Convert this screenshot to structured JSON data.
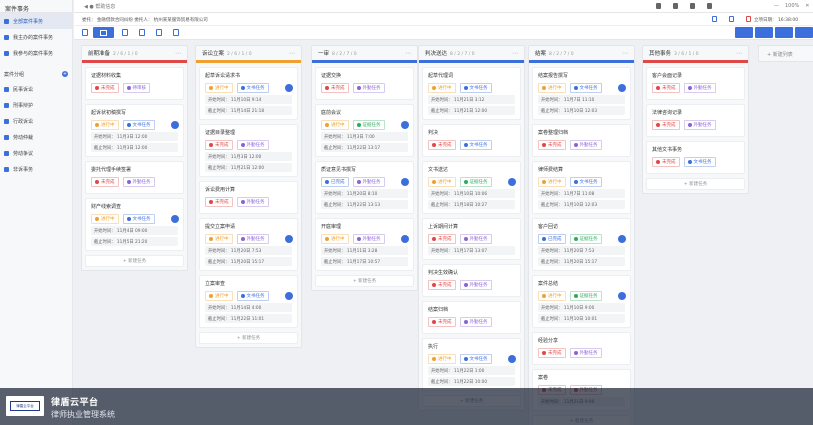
{
  "sidebar": {
    "title": "案件事务",
    "items": [
      "全部案件事务",
      "我主办的案件事务",
      "我参与的案件事务"
    ],
    "group_title": "案件分组",
    "groups": [
      "民事诉讼",
      "刑事辩护",
      "行政诉讼",
      "劳动仲裁",
      "劳动争议",
      "非诉事务"
    ]
  },
  "topbar": {
    "crumb": "◀  ●  帮助信息",
    "zoom": "100%",
    "minimize": "—",
    "close": "✕"
  },
  "infobar": {
    "text": "委托：  金融借款合同纠纷      委托人： 杭州某某服饰贸易有限公司",
    "time_label": "立项日期：",
    "time_value": "16:38:00"
  },
  "new_column_label": "+ 新建列表",
  "add_task_label": "+ 新建任务",
  "colors": {
    "accent": "#3d6fdc",
    "red": "#e04848",
    "orange": "#f0a030",
    "green": "#2faa5c"
  },
  "columns": [
    {
      "title": "前期准备",
      "count": "2 / 6 / 1 / 0",
      "bar": "#e04848",
      "cards": [
        {
          "title": "证据材料收集",
          "tags": [
            {
              "text": "未完成",
              "c": "#e04848"
            },
            {
              "text": "待审核",
              "c": "#8a63d2"
            }
          ],
          "dates": [],
          "avatar": false
        },
        {
          "title": "起诉状初稿撰写",
          "tags": [
            {
              "text": "进行中",
              "c": "#f0a030"
            },
            {
              "text": "文书任务",
              "c": "#3d6fdc"
            }
          ],
          "dates": [
            "开始时间： 11月3日 12:00",
            "截止时间： 11月3日 12:00"
          ],
          "avatar": true
        },
        {
          "title": "委托代理手续签署",
          "tags": [
            {
              "text": "未完成",
              "c": "#e04848"
            },
            {
              "text": "外勤任务",
              "c": "#8a63d2"
            }
          ],
          "dates": [],
          "avatar": false
        },
        {
          "title": "财产线索调查",
          "tags": [
            {
              "text": "进行中",
              "c": "#f0a030"
            },
            {
              "text": "文书任务",
              "c": "#3d6fdc"
            }
          ],
          "dates": [
            "开始时间： 11月4日 09:00",
            "截止时间： 11月5日 21:20"
          ],
          "avatar": true
        }
      ]
    },
    {
      "title": "诉讼立案",
      "count": "2 / 6 / 1 / 0",
      "bar": "#f0a030",
      "cards": [
        {
          "title": "起草诉讼请求书",
          "tags": [
            {
              "text": "进行中",
              "c": "#f0a030"
            },
            {
              "text": "文书任务",
              "c": "#3d6fdc"
            }
          ],
          "dates": [
            "开始时间： 11月10日 9:14",
            "截止时间： 11月14日 21:18"
          ],
          "avatar": true
        },
        {
          "title": "证据目录整理",
          "tags": [
            {
              "text": "未完成",
              "c": "#e04848"
            },
            {
              "text": "外勤任务",
              "c": "#8a63d2"
            }
          ],
          "dates": [
            "开始时间： 11月3日 12:00",
            "截止时间： 11月21日 12:00"
          ],
          "avatar": false
        },
        {
          "title": "诉讼费用计算",
          "tags": [
            {
              "text": "未完成",
              "c": "#e04848"
            },
            {
              "text": "外勤任务",
              "c": "#8a63d2"
            }
          ],
          "dates": [],
          "avatar": false
        },
        {
          "title": "提交立案申请",
          "tags": [
            {
              "text": "进行中",
              "c": "#f0a030"
            },
            {
              "text": "外勤任务",
              "c": "#8a63d2"
            }
          ],
          "dates": [
            "开始时间： 11月20日 7:53",
            "截止时间： 11月20日 15:17"
          ],
          "avatar": true
        },
        {
          "title": "立案审查",
          "tags": [
            {
              "text": "进行中",
              "c": "#f0a030"
            },
            {
              "text": "文书任务",
              "c": "#3d6fdc"
            }
          ],
          "dates": [
            "开始时间： 11月14日 4:00",
            "截止时间： 11月22日 11:01"
          ],
          "avatar": true
        }
      ]
    },
    {
      "title": "一审",
      "count": "8 / 2 / 7 / 0",
      "bar": "#3d6fdc",
      "cards": [
        {
          "title": "证据交换",
          "tags": [
            {
              "text": "未完成",
              "c": "#e04848"
            },
            {
              "text": "外勤任务",
              "c": "#8a63d2"
            }
          ],
          "dates": [],
          "avatar": false
        },
        {
          "title": "庭前会议",
          "tags": [
            {
              "text": "进行中",
              "c": "#f0a030"
            },
            {
              "text": "证据任务",
              "c": "#2faa5c"
            }
          ],
          "dates": [
            "开始时间： 11月3日 7:00",
            "截止时间： 11月22日 13:17"
          ],
          "avatar": true
        },
        {
          "title": "质证意见书撰写",
          "tags": [
            {
              "text": "已完成",
              "c": "#3d6fdc"
            },
            {
              "text": "外勤任务",
              "c": "#8a63d2"
            }
          ],
          "dates": [
            "开始时间： 11月20日 8:10",
            "截止时间： 11月22日 13:13"
          ],
          "avatar": true
        },
        {
          "title": "开庭审理",
          "tags": [
            {
              "text": "进行中",
              "c": "#f0a030"
            },
            {
              "text": "外勤任务",
              "c": "#8a63d2"
            }
          ],
          "dates": [
            "开始时间： 11月11日 3:28",
            "截止时间： 11月17日 10:57"
          ],
          "avatar": true
        }
      ]
    },
    {
      "title": "判决送达",
      "count": "8 / 2 / 7 / 0",
      "bar": "#3d6fdc",
      "cards": [
        {
          "title": "起草代理词",
          "tags": [
            {
              "text": "进行中",
              "c": "#f0a030"
            },
            {
              "text": "文书任务",
              "c": "#3d6fdc"
            }
          ],
          "dates": [
            "开始时间： 11月21日 3:12",
            "截止时间： 11月21日 12:00"
          ],
          "avatar": false
        },
        {
          "title": "判决",
          "tags": [
            {
              "text": "未完成",
              "c": "#e04848"
            },
            {
              "text": "文书任务",
              "c": "#3d6fdc"
            }
          ],
          "dates": [],
          "avatar": false
        },
        {
          "title": "文书送达",
          "tags": [
            {
              "text": "进行中",
              "c": "#f0a030"
            },
            {
              "text": "证据任务",
              "c": "#2faa5c"
            }
          ],
          "dates": [
            "开始时间： 11月10日 10:06",
            "截止时间： 11月18日 10:27"
          ],
          "avatar": true
        },
        {
          "title": "上诉期间计算",
          "tags": [
            {
              "text": "未完成",
              "c": "#e04848"
            },
            {
              "text": "外勤任务",
              "c": "#8a63d2"
            }
          ],
          "dates": [
            "开始时间： 11月17日 13:07"
          ],
          "avatar": false
        },
        {
          "title": "判决生效确认",
          "tags": [
            {
              "text": "未完成",
              "c": "#e04848"
            },
            {
              "text": "外勤任务",
              "c": "#8a63d2"
            }
          ],
          "dates": [],
          "avatar": false
        },
        {
          "title": "结案归档",
          "tags": [
            {
              "text": "未完成",
              "c": "#e04848"
            },
            {
              "text": "外勤任务",
              "c": "#8a63d2"
            }
          ],
          "dates": [],
          "avatar": false
        },
        {
          "title": "执行",
          "tags": [
            {
              "text": "进行中",
              "c": "#f0a030"
            },
            {
              "text": "文书任务",
              "c": "#3d6fdc"
            }
          ],
          "dates": [
            "开始时间： 11月22日 1:00",
            "截止时间： 11月22日 10:00"
          ],
          "avatar": true
        }
      ]
    },
    {
      "title": "结案",
      "count": "8 / 2 / 7 / 0",
      "bar": "#3d6fdc",
      "cards": [
        {
          "title": "结案报告撰写",
          "tags": [
            {
              "text": "进行中",
              "c": "#f0a030"
            },
            {
              "text": "文书任务",
              "c": "#3d6fdc"
            }
          ],
          "dates": [
            "开始时间： 11月7日 11:10",
            "截止时间： 11月10日 12:03"
          ],
          "avatar": true
        },
        {
          "title": "案卷整理归档",
          "tags": [
            {
              "text": "未完成",
              "c": "#e04848"
            },
            {
              "text": "外勤任务",
              "c": "#8a63d2"
            }
          ],
          "dates": [],
          "avatar": false
        },
        {
          "title": "律师费结算",
          "tags": [
            {
              "text": "进行中",
              "c": "#f0a030"
            },
            {
              "text": "文书任务",
              "c": "#3d6fdc"
            }
          ],
          "dates": [
            "开始时间： 11月7日 11:08",
            "截止时间： 11月10日 12:03"
          ],
          "avatar": false
        },
        {
          "title": "客户回访",
          "tags": [
            {
              "text": "已完成",
              "c": "#3d6fdc"
            },
            {
              "text": "证据任务",
              "c": "#2faa5c"
            }
          ],
          "dates": [
            "开始时间： 11月20日 7:53",
            "截止时间： 11月20日 15:17"
          ],
          "avatar": true
        },
        {
          "title": "案件总结",
          "tags": [
            {
              "text": "进行中",
              "c": "#f0a030"
            },
            {
              "text": "证据任务",
              "c": "#2faa5c"
            }
          ],
          "dates": [
            "开始时间： 11月10日 9:00",
            "截止时间： 11月10日 10:01"
          ],
          "avatar": true
        },
        {
          "title": "经验分享",
          "tags": [
            {
              "text": "未完成",
              "c": "#e04848"
            },
            {
              "text": "外勤任务",
              "c": "#8a63d2"
            }
          ],
          "dates": [],
          "avatar": false
        },
        {
          "title": "案卷",
          "tags": [
            {
              "text": "未完成",
              "c": "#e04848"
            },
            {
              "text": "外勤任务",
              "c": "#e04848"
            }
          ],
          "dates": [
            "开始时间： 11月21日 9:00"
          ],
          "avatar": false
        }
      ]
    },
    {
      "title": "其他事务",
      "count": "3 / 6 / 1 / 0",
      "bar": "#e04848",
      "cards": [
        {
          "title": "客户会面记录",
          "tags": [
            {
              "text": "未完成",
              "c": "#e04848"
            },
            {
              "text": "外勤任务",
              "c": "#8a63d2"
            }
          ],
          "dates": [],
          "avatar": false
        },
        {
          "title": "法律咨询记录",
          "tags": [
            {
              "text": "未完成",
              "c": "#e04848"
            },
            {
              "text": "外勤任务",
              "c": "#8a63d2"
            }
          ],
          "dates": [],
          "avatar": false
        },
        {
          "title": "其他文书事务",
          "tags": [
            {
              "text": "未完成",
              "c": "#e04848"
            },
            {
              "text": "文书任务",
              "c": "#3d6fdc"
            }
          ],
          "dates": [],
          "avatar": false
        }
      ]
    }
  ],
  "footer": {
    "logo_text": "律盾云平台",
    "brand": "律盾云平台",
    "subtitle": "律师执业管理系统"
  }
}
